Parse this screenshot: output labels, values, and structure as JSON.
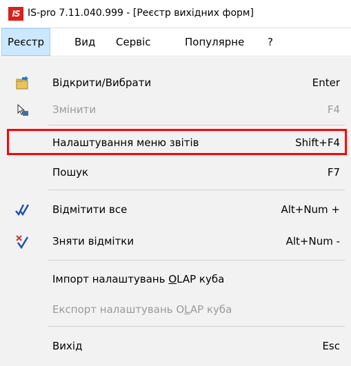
{
  "window": {
    "title": "IS-pro 7.11.040.999 - [Реєстр вихідних форм]",
    "app_icon_text": "IS"
  },
  "menubar": {
    "items": [
      {
        "label": "Реєстр",
        "active": true
      },
      {
        "label": "Вид"
      },
      {
        "label": "Сервіс"
      },
      {
        "label": "Популярне"
      },
      {
        "label": "?"
      }
    ]
  },
  "dropdown": {
    "items": [
      {
        "label": "Відкрити/Вибрати",
        "shortcut": "Enter",
        "icon": "folder-open-icon",
        "enabled": true
      },
      {
        "label": "Змінити",
        "shortcut": "F4",
        "icon": "edit-pointer-icon",
        "enabled": false
      },
      {
        "label": "Налаштування меню звітів",
        "shortcut": "Shift+F4",
        "enabled": true,
        "highlighted": true
      },
      {
        "label": "Пошук",
        "shortcut": "F7",
        "enabled": true
      },
      {
        "label": "Відмітити все",
        "shortcut": "Alt+Num +",
        "icon": "check-all-icon",
        "enabled": true
      },
      {
        "label": "Зняти відмітки",
        "shortcut": "Alt+Num -",
        "icon": "uncheck-all-icon",
        "enabled": true
      },
      {
        "label_pre": "Імпорт налаштувань ",
        "label_u": "O",
        "label_post": "LAP куба",
        "enabled": true
      },
      {
        "label_pre": "Експорт налаштувань O",
        "label_u": "L",
        "label_post": "AP куба",
        "enabled": false
      },
      {
        "label": "Вихід",
        "shortcut": "Esc",
        "enabled": true
      }
    ]
  },
  "colors": {
    "highlight_border": "#ff0000",
    "menu_active_bg": "#cce8ff",
    "dropdown_bg": "#f2f2f2",
    "disabled_text": "#9a9a9a"
  }
}
